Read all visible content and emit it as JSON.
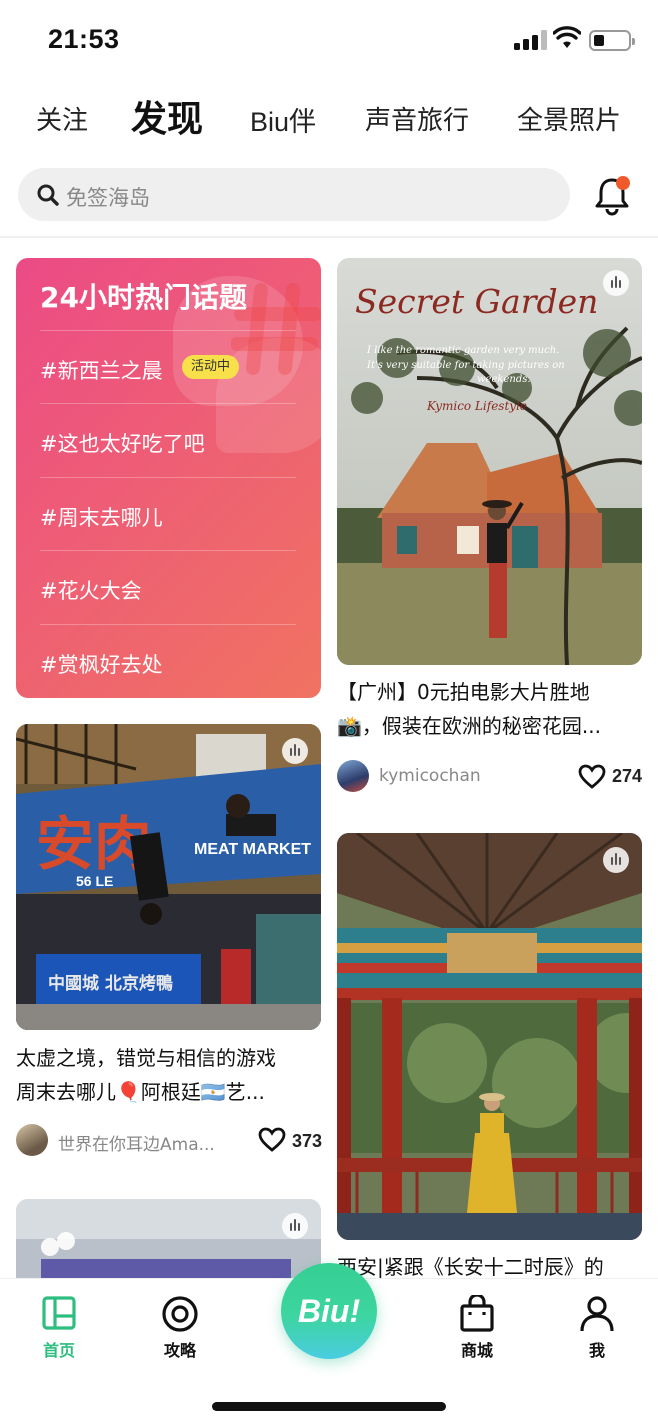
{
  "status_bar": {
    "time": "21:53"
  },
  "tabs": [
    {
      "label": "关注"
    },
    {
      "label": "发现"
    },
    {
      "label": "Biu伴"
    },
    {
      "label": "声音旅行"
    },
    {
      "label": "全景照片"
    }
  ],
  "active_tab": "发现",
  "search": {
    "placeholder": "免签海岛"
  },
  "topics": {
    "title": "24小时热门话题",
    "items": [
      {
        "label": "#新西兰之晨",
        "badge": "活动中"
      },
      {
        "label": "#这也太好吃了吧"
      },
      {
        "label": "#周末去哪儿"
      },
      {
        "label": "#花火大会"
      },
      {
        "label": "#赏枫好去处"
      }
    ]
  },
  "feed": [
    {
      "caption_line1": "【广州】0元拍电影大片胜地",
      "caption_line2": "📸，假装在欧洲的秘密花园...",
      "image_text": {
        "title": "Secret Garden",
        "line1": "I like the romantic garden very much.",
        "line2": "It's very suitable for taking pictures on",
        "line3": "weekends.",
        "sign": "Kymico Lifestyle"
      },
      "author": "kymicochan",
      "likes": "274"
    },
    {
      "caption_line1": "太虚之境，错觉与相信的游戏",
      "caption_line2": "周末去哪儿🎈阿根廷🇦🇷艺...",
      "image_text": {
        "sign1": "安肉",
        "sign2": "MEAT MARKET",
        "sign3": "56 LE",
        "sign4": "中國城 北京烤鴨"
      },
      "author": "世界在你耳边Ama...",
      "likes": "373"
    },
    {
      "caption_line1": "西安|紧跟《长安十二时辰》的",
      "author": "",
      "likes": ""
    },
    {
      "caption_line1": "",
      "author": "",
      "likes": ""
    }
  ],
  "bottom_nav": [
    {
      "label": "首页",
      "icon": "home-icon"
    },
    {
      "label": "攻略",
      "icon": "target-icon"
    },
    {
      "label": "Biu!",
      "icon": "biu-button"
    },
    {
      "label": "商城",
      "icon": "bag-icon"
    },
    {
      "label": "我",
      "icon": "user-icon"
    }
  ],
  "colors": {
    "accent": "#2dbd7e",
    "topic_start": "#ec4b86",
    "topic_end": "#f07361",
    "notification_dot": "#f05a2a"
  }
}
